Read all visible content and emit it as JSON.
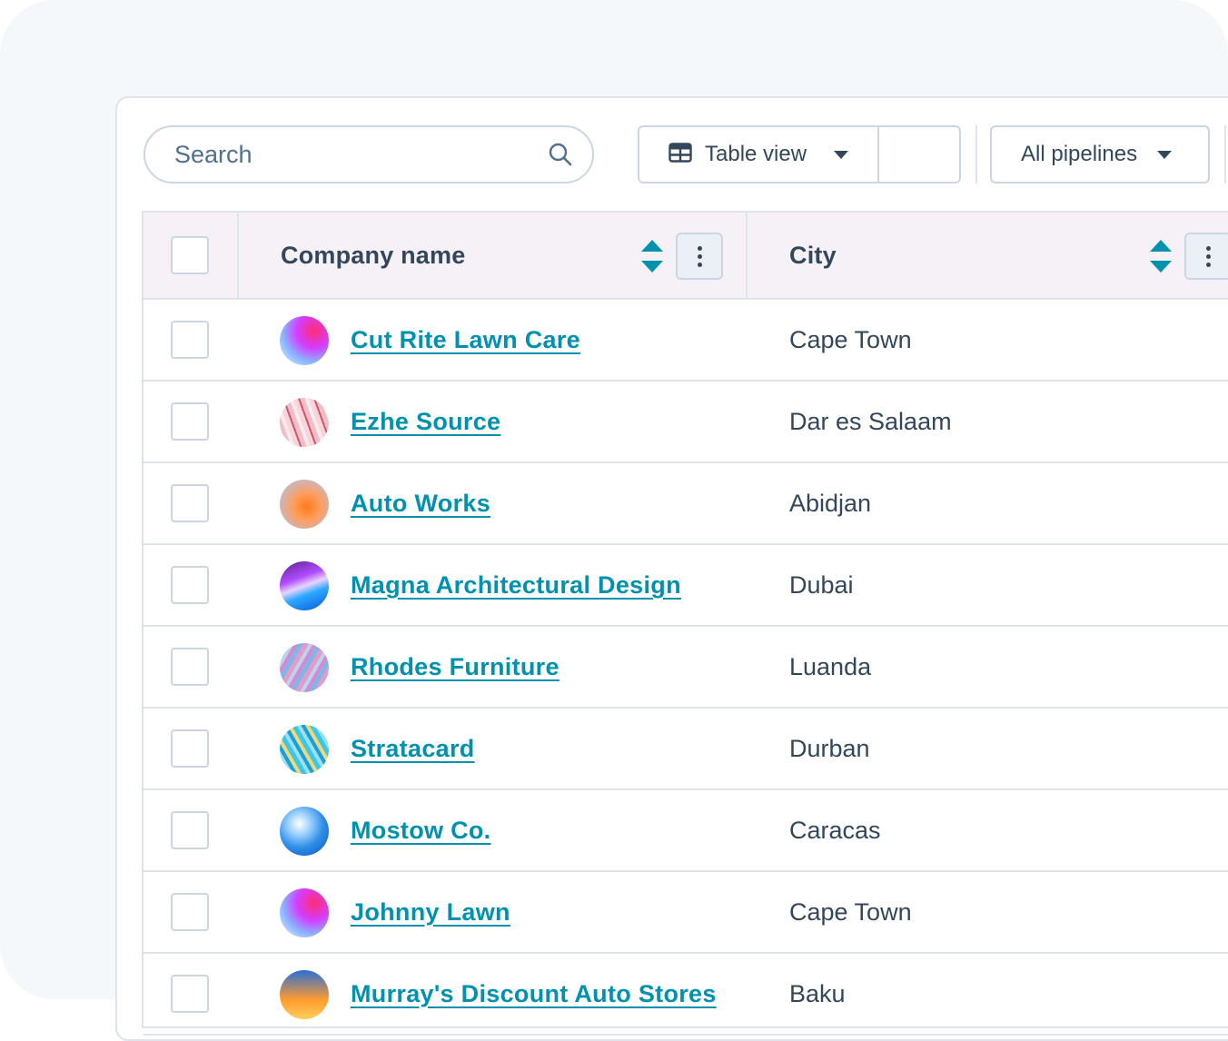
{
  "toolbar": {
    "search": {
      "placeholder": "Search",
      "value": ""
    },
    "view_select": {
      "label": "Table view"
    },
    "pipelines_select": {
      "label": "All pipelines"
    }
  },
  "table": {
    "columns": [
      {
        "label": "Company name"
      },
      {
        "label": "City"
      }
    ],
    "rows": [
      {
        "company": "Cut Rite Lawn Care",
        "city": "Cape Town"
      },
      {
        "company": "Ezhe Source",
        "city": "Dar es Salaam"
      },
      {
        "company": "Auto Works",
        "city": "Abidjan"
      },
      {
        "company": "Magna Architectural Design",
        "city": "Dubai"
      },
      {
        "company": "Rhodes Furniture",
        "city": "Luanda"
      },
      {
        "company": "Stratacard",
        "city": "Durban"
      },
      {
        "company": "Mostow Co.",
        "city": "Caracas"
      },
      {
        "company": "Johnny Lawn",
        "city": "Cape Town"
      },
      {
        "company": "Murray's Discount Auto Stores",
        "city": "Baku"
      }
    ]
  },
  "colors": {
    "link": "#0091ae",
    "text": "#33475b",
    "border": "#dfe3eb",
    "header_bg": "#f6f1f6",
    "sort_icon": "#0091ae"
  }
}
